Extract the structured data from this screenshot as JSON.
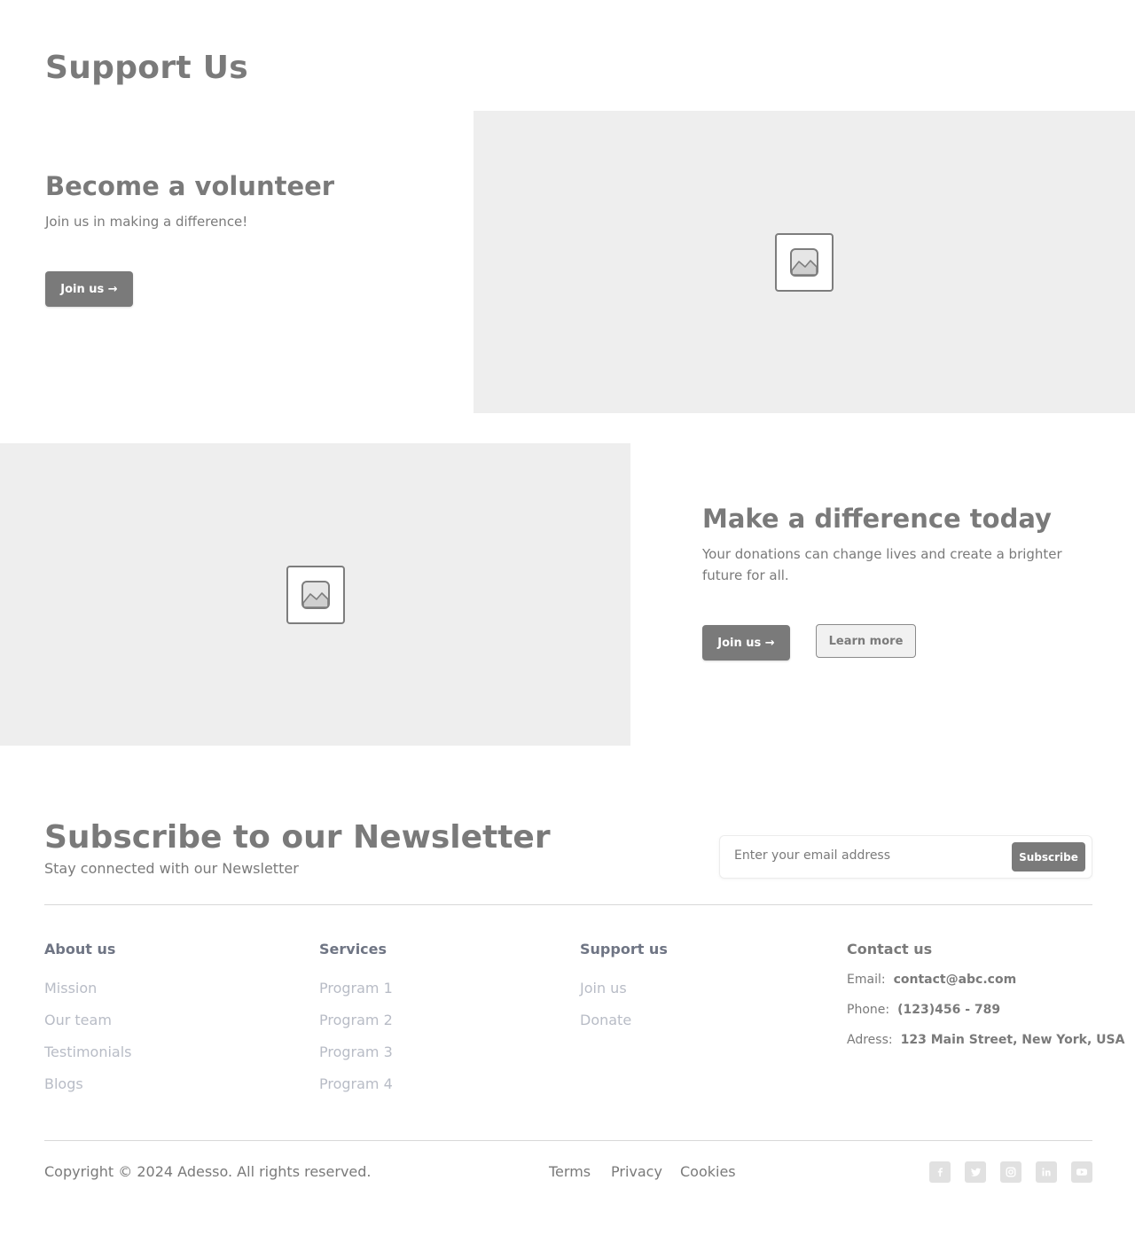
{
  "page_title": "Support Us",
  "volunteer": {
    "title": "Become a volunteer",
    "subtitle": "Join us in making a difference!",
    "join_label": "Join us →"
  },
  "difference": {
    "title": "Make a difference today",
    "subtitle": "Your donations can change lives and create a brighter future for all.",
    "join_label": "Join us →",
    "learn_label": "Learn more"
  },
  "newsletter": {
    "title": "Subscribe to our Newsletter",
    "subtitle": "Stay connected with our Newsletter",
    "placeholder": "Enter your email address",
    "button_label": "Subscribe"
  },
  "footer": {
    "about": {
      "title": "About us",
      "links": [
        "Mission",
        "Our team",
        "Testimonials",
        "Blogs"
      ]
    },
    "services": {
      "title": "Services",
      "links": [
        "Program 1",
        "Program 2",
        "Program 3",
        "Program 4"
      ]
    },
    "support": {
      "title": "Support us",
      "links": [
        "Join us",
        "Donate"
      ]
    },
    "contact": {
      "title": "Contact us",
      "email_label": "Email:",
      "email": "contact@abc.com",
      "phone_label": "Phone:",
      "phone": "(123)456 - 789",
      "address_label": "Adress:",
      "address": "123 Main Street, New York, USA"
    },
    "copyright": "Copyright © 2024 Adesso. All rights reserved.",
    "legal": [
      "Terms",
      "Privacy",
      "Cookies"
    ],
    "social_icons": [
      "facebook-icon",
      "twitter-icon",
      "instagram-icon",
      "linkedin-icon",
      "youtube-icon"
    ]
  },
  "colors": {
    "text": "#7a7a7a",
    "button": "#7a7a7a",
    "placeholder_bg": "#eeeeee",
    "footer_heading": "#6f7584",
    "footer_link": "#b8bcc6"
  }
}
